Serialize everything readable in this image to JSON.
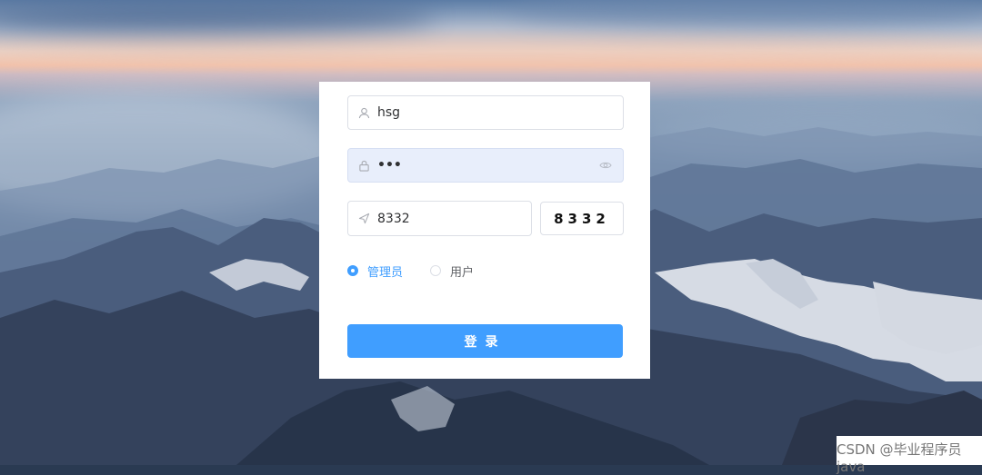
{
  "login": {
    "username": "hsg",
    "password_mask": "•••",
    "code_input": "8332",
    "captcha": "8332",
    "roles": [
      "管理员",
      "用户"
    ],
    "selected_role": "管理员",
    "submit_label": "登录"
  },
  "watermark": "CSDN @毕业程序员java",
  "icons": {
    "username": "user-icon",
    "password": "lock-icon",
    "password_toggle": "eye-icon",
    "code": "send-icon"
  },
  "colors": {
    "primary": "#409eff",
    "password_fill": "#e8eefb"
  }
}
